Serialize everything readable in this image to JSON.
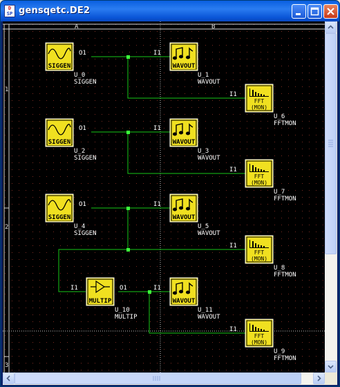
{
  "window": {
    "title": "gensqetc.DE2",
    "app_icon_text_top": "D",
    "app_icon_text_bottom": "SP",
    "controls": [
      "minimize",
      "maximize",
      "close"
    ]
  },
  "canvas": {
    "columns": [
      "A",
      "B"
    ],
    "rows": [
      "1",
      "2",
      "3"
    ]
  },
  "blocks": [
    {
      "id": "U_0",
      "type": "SIGGEN",
      "icon": "sine-wave-icon",
      "icon_label": "SIGGEN",
      "port": "O1"
    },
    {
      "id": "U_1",
      "type": "WAVOUT",
      "icon": "music-notes-icon",
      "icon_label": "WAVOUT",
      "port": "I1"
    },
    {
      "id": "U_6",
      "type": "FFTMON",
      "icon": "spectrum-icon",
      "icon_label": "FFT",
      "icon_sublabel": "(MON)",
      "port": "I1"
    },
    {
      "id": "U_2",
      "type": "SIGGEN",
      "icon": "sine-wave-icon",
      "icon_label": "SIGGEN",
      "port": "O1"
    },
    {
      "id": "U_3",
      "type": "WAVOUT",
      "icon": "music-notes-icon",
      "icon_label": "WAVOUT",
      "port": "I1"
    },
    {
      "id": "U_7",
      "type": "FFTMON",
      "icon": "spectrum-icon",
      "icon_label": "FFT",
      "icon_sublabel": "(MON)",
      "port": "I1"
    },
    {
      "id": "U_4",
      "type": "SIGGEN",
      "icon": "sine-wave-icon",
      "icon_label": "SIGGEN",
      "port": "O1"
    },
    {
      "id": "U_5",
      "type": "WAVOUT",
      "icon": "music-notes-icon",
      "icon_label": "WAVOUT",
      "port": "I1"
    },
    {
      "id": "U_8",
      "type": "FFTMON",
      "icon": "spectrum-icon",
      "icon_label": "FFT",
      "icon_sublabel": "(MON)",
      "port": "I1"
    },
    {
      "id": "U_10",
      "type": "MULTIP",
      "icon": "amplifier-icon",
      "icon_label": "MULTIP",
      "port_in": "I1",
      "port": "O1"
    },
    {
      "id": "U_11",
      "type": "WAVOUT",
      "icon": "music-notes-icon",
      "icon_label": "WAVOUT",
      "port": "I1"
    },
    {
      "id": "U_9",
      "type": "FFTMON",
      "icon": "spectrum-icon",
      "icon_label": "FFT",
      "icon_sublabel": "(MON)",
      "port": "I1"
    }
  ],
  "colors": {
    "canvas_bg": "#000000",
    "grid_dot": "#7a2a20",
    "wire": "#18c818",
    "junction": "#3cff3c",
    "block_bg": "#f0e020",
    "block_border": "#ffffff",
    "text": "#ffffff",
    "cursor_line": "#c8c8c8",
    "title_bar": "#0a5fe0"
  }
}
